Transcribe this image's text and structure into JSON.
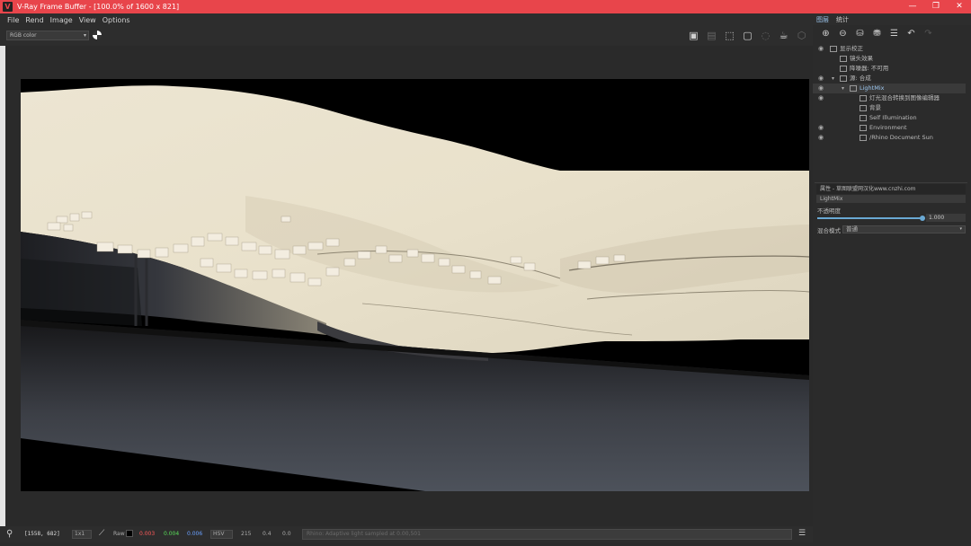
{
  "window": {
    "title": "V-Ray Frame Buffer - [100.0% of 1600 x 821]",
    "logo_text": "V",
    "controls": {
      "minimize": "—",
      "maximize": "❐",
      "close": "✕"
    }
  },
  "menu": {
    "file": "File",
    "render": "Rend",
    "image": "Image",
    "view": "View",
    "options": "Options"
  },
  "toolbar": {
    "channel_select": "RGB color",
    "right_icons": [
      "save-icon",
      "save-all-icon",
      "region-icon",
      "crop-icon",
      "render-icon",
      "teapot-icon",
      "stop-icon"
    ]
  },
  "bottom": {
    "coords": "[1558, 682]",
    "pick_mode": "1x1",
    "raw_label": "Raw",
    "r": "0.003",
    "g": "0.004",
    "b": "0.006",
    "mode": "HSV",
    "h": "215",
    "s": "0.4",
    "v": "0.0",
    "status": "Rhino: Adaptive light sampled at 0.00,501"
  },
  "panel": {
    "tabs": {
      "layers": "图层",
      "stats": "统计"
    },
    "layers": [
      {
        "label": "显示校正"
      },
      {
        "label": "镜头效果"
      },
      {
        "label": "降噪器: 不可用"
      },
      {
        "label": "源: 合成"
      },
      {
        "label": "LightMix"
      },
      {
        "label": "灯光混合转换到图像编辑器"
      },
      {
        "label": "背景"
      },
      {
        "label": "Self Illumination"
      },
      {
        "label": "Environment"
      },
      {
        "label": "/Rhino Document Sun"
      }
    ],
    "props_title": "属性 - 草图联盟网汉化www.cnzhi.com",
    "props_name": "LightMix",
    "opacity_label": "不透明度",
    "opacity_value": "1.000",
    "opacity": 1.0,
    "blend_label": "混合模式",
    "blend_value": "普通"
  }
}
